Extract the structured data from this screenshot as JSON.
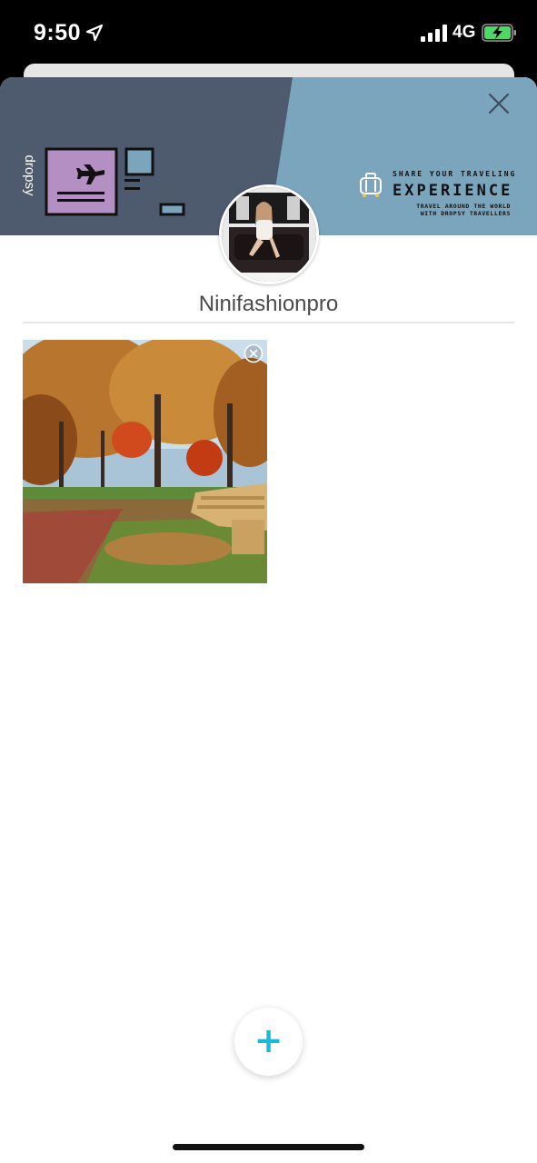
{
  "status_bar": {
    "time": "9:50",
    "network": "4G",
    "location_icon": "location-arrow-icon",
    "signal_icon": "signal-bars-icon",
    "battery_icon": "battery-charging-icon",
    "battery_color": "#4cd964"
  },
  "banner": {
    "logo_text": "dropsy",
    "share_text": "SHARE YOUR TRAVELING",
    "experience_text": "EXPERIENCE",
    "travel_line1": "TRAVEL AROUND THE WORLD",
    "travel_line2": "WITH DROPSY TRAVELLERS",
    "colors": {
      "dark": "#4e5a6e",
      "light": "#7aa5bd",
      "postcard": "#b48fc4"
    }
  },
  "profile": {
    "username": "Ninifashionpro"
  },
  "gallery": {
    "photos": [
      {
        "remove_icon": "close-circle-icon"
      }
    ]
  },
  "actions": {
    "close_icon": "close-icon",
    "add_label": "+",
    "accent": "#19b9d8"
  }
}
